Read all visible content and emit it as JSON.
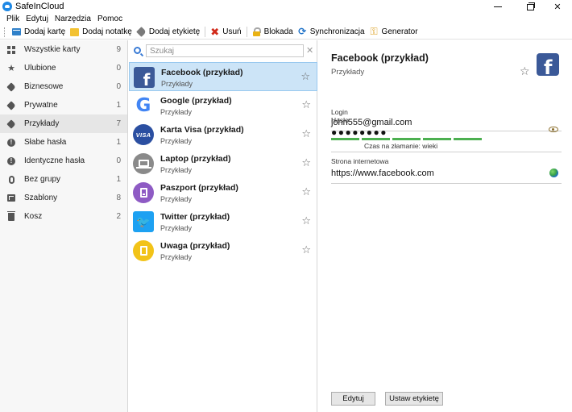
{
  "window": {
    "title": "SafeInCloud"
  },
  "menu": [
    "Plik",
    "Edytuj",
    "Narzędzia",
    "Pomoc"
  ],
  "toolbar": {
    "add_card": "Dodaj kartę",
    "add_note": "Dodaj notatkę",
    "add_label": "Dodaj etykietę",
    "delete": "Usuń",
    "lock": "Blokada",
    "sync": "Synchronizacja",
    "generator": "Generator"
  },
  "sidebar": {
    "items": [
      {
        "label": "Wszystkie karty",
        "count": "9",
        "icon": "grid-icon"
      },
      {
        "label": "Ulubione",
        "count": "0",
        "icon": "star-icon"
      },
      {
        "label": "Biznesowe",
        "count": "0",
        "icon": "tag-icon"
      },
      {
        "label": "Prywatne",
        "count": "1",
        "icon": "tag-icon"
      },
      {
        "label": "Przykłady",
        "count": "7",
        "icon": "tag-icon",
        "active": true
      },
      {
        "label": "Słabe hasła",
        "count": "1",
        "icon": "alert-icon"
      },
      {
        "label": "Identyczne hasła",
        "count": "0",
        "icon": "alert-icon"
      },
      {
        "label": "Bez grupy",
        "count": "1",
        "icon": "paperclip-icon"
      },
      {
        "label": "Szablony",
        "count": "8",
        "icon": "templates-icon"
      },
      {
        "label": "Kosz",
        "count": "2",
        "icon": "trash-icon"
      }
    ]
  },
  "search": {
    "placeholder": "Szukaj",
    "value": ""
  },
  "cards": [
    {
      "title": "Facebook (przykład)",
      "subtitle": "Przykłady",
      "icon": "facebook-icon",
      "selected": true
    },
    {
      "title": "Google (przykład)",
      "subtitle": "Przykłady",
      "icon": "google-icon"
    },
    {
      "title": "Karta Visa (przykład)",
      "subtitle": "Przykłady",
      "icon": "visa-icon"
    },
    {
      "title": "Laptop (przykład)",
      "subtitle": "Przykłady",
      "icon": "laptop-icon"
    },
    {
      "title": "Paszport (przykład)",
      "subtitle": "Przykłady",
      "icon": "passport-icon"
    },
    {
      "title": "Twitter (przykład)",
      "subtitle": "Przykłady",
      "icon": "twitter-icon"
    },
    {
      "title": "Uwaga (przykład)",
      "subtitle": "Przykłady",
      "icon": "note-icon"
    }
  ],
  "detail": {
    "title": "Facebook (przykład)",
    "subtitle": "Przykłady",
    "login_label": "Login",
    "login_value": "john555@gmail.com",
    "password_label": "Hasło",
    "password_value": "●●●●●●●●",
    "password_strength": 1.0,
    "crack_time": "Czas na złamanie: wieki",
    "website_label": "Strona internetowa",
    "website_value": "https://www.facebook.com",
    "edit_button": "Edytuj",
    "set_labels_button": "Ustaw etykietę"
  },
  "colors": {
    "selection": "#cce4f7",
    "strength_bar": "#4caf50",
    "facebook": "#3b5998",
    "twitter": "#1da1f2"
  }
}
